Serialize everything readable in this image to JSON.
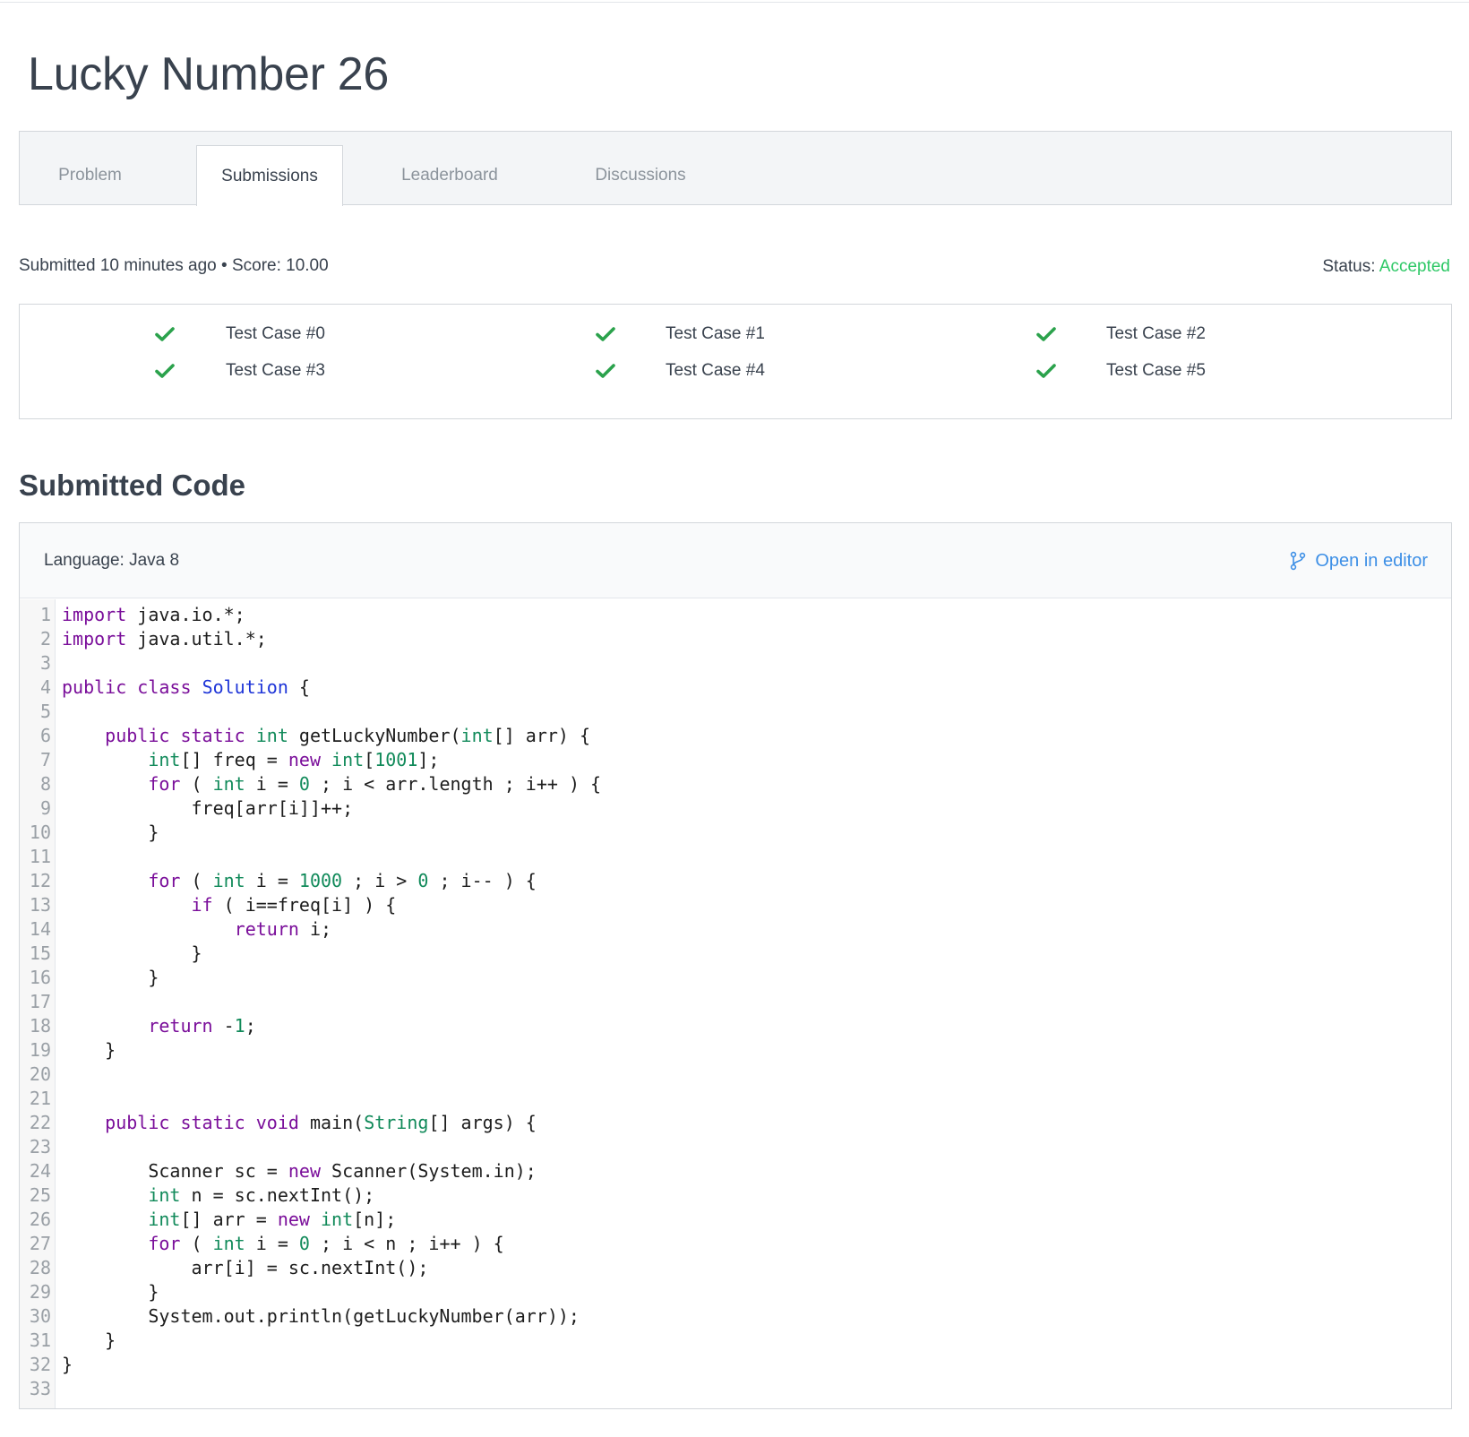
{
  "page_title": "Lucky Number 26",
  "tabs": [
    {
      "label": "Problem",
      "active": false
    },
    {
      "label": "Submissions",
      "active": true
    },
    {
      "label": "Leaderboard",
      "active": false
    },
    {
      "label": "Discussions",
      "active": false
    }
  ],
  "submission": {
    "meta": "Submitted 10 minutes ago • Score: 10.00",
    "status_label": "Status:",
    "status_value": "Accepted"
  },
  "test_cases": [
    {
      "label": "Test Case #0",
      "passed": true
    },
    {
      "label": "Test Case #1",
      "passed": true
    },
    {
      "label": "Test Case #2",
      "passed": true
    },
    {
      "label": "Test Case #3",
      "passed": true
    },
    {
      "label": "Test Case #4",
      "passed": true
    },
    {
      "label": "Test Case #5",
      "passed": true
    }
  ],
  "code_section": {
    "title": "Submitted Code",
    "language": "Language: Java 8",
    "open_editor_label": "Open in editor",
    "lines": [
      "import java.io.*;",
      "import java.util.*;",
      "",
      "public class Solution {",
      "",
      "    public static int getLuckyNumber(int[] arr) {",
      "        int[] freq = new int[1001];",
      "        for ( int i = 0 ; i < arr.length ; i++ ) {",
      "            freq[arr[i]]++;",
      "        }",
      "",
      "        for ( int i = 1000 ; i > 0 ; i-- ) {",
      "            if ( i==freq[i] ) {",
      "                return i;",
      "            }",
      "        }",
      "",
      "        return -1;",
      "    }",
      "",
      "",
      "    public static void main(String[] args) {",
      "",
      "        Scanner sc = new Scanner(System.in);",
      "        int n = sc.nextInt();",
      "        int[] arr = new int[n];",
      "        for ( int i = 0 ; i < n ; i++ ) {",
      "            arr[i] = sc.nextInt();",
      "        }",
      "        System.out.println(getLuckyNumber(arr));",
      "    }",
      "}",
      ""
    ]
  },
  "colors": {
    "accent_green": "#2ec866",
    "check_green": "#2ba24c",
    "link_blue": "#3d8fe6",
    "keyword": "#7a0e9a",
    "type": "#118a5a",
    "class_name": "#1e35d8"
  },
  "icons": {
    "test_pass": "check-icon",
    "open_editor": "branch-icon"
  }
}
